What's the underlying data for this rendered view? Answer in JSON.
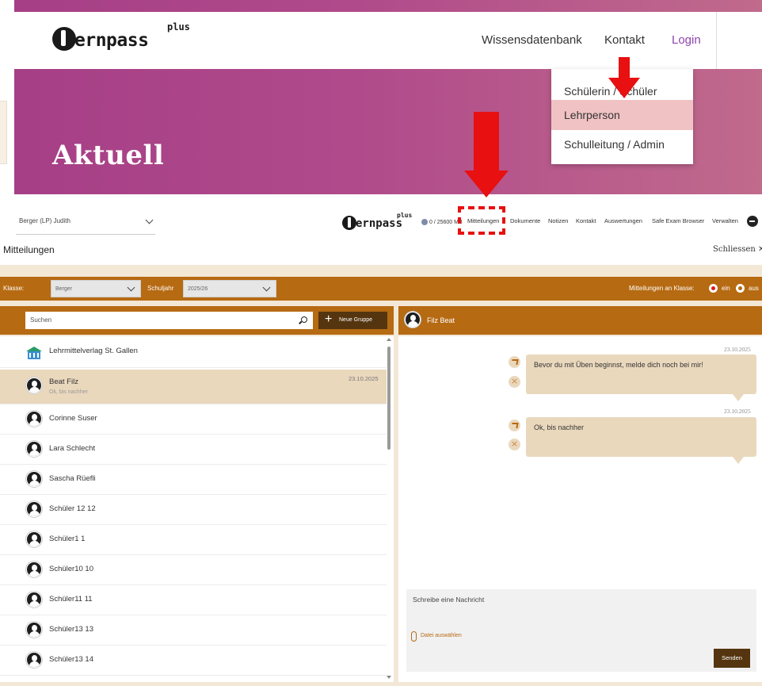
{
  "website": {
    "logo_text": "ernpass",
    "logo_sup": "plus",
    "nav": [
      "Wissensdatenbank",
      "Kontakt",
      "Login"
    ],
    "hero_title": "Aktuell",
    "login_dropdown": [
      "Schülerin / Schüler",
      "Lehrperson",
      "Schulleitung / Admin"
    ]
  },
  "app": {
    "user_selector": "Berger (LP) Judith",
    "logo_text": "ernpass",
    "logo_sup": "plus",
    "quota": "0 / 25600 MB",
    "nav": [
      "Mitteilungen",
      "Dokumente",
      "Notizen",
      "Kontakt",
      "Auswertungen",
      "Safe Exam Browser",
      "Verwalten"
    ],
    "page_title": "Mitteilungen",
    "close_label": "Schliessen"
  },
  "class_bar": {
    "class_label": "Klasse:",
    "class_value": "Berger",
    "year_label": "Schuljahr",
    "year_value": "2025/26",
    "messages_label": "Mitteilungen an Klasse:",
    "on_label": "ein",
    "off_label": "aus",
    "messages_enabled": true
  },
  "search": {
    "placeholder": "Suchen",
    "new_group_label": "Neue Gruppe"
  },
  "contacts": [
    {
      "name": "Lehrmittelverlag St. Gallen",
      "type": "school"
    },
    {
      "name": "Beat Filz",
      "preview": "Ok, bis nachher",
      "date": "23.10.2025",
      "selected": true
    },
    {
      "name": "Corinne Suser"
    },
    {
      "name": "Lara Schlecht"
    },
    {
      "name": "Sascha Rüefli"
    },
    {
      "name": "Schüler 12 12"
    },
    {
      "name": "Schüler1 1"
    },
    {
      "name": "Schüler10 10"
    },
    {
      "name": "Schüler11 11"
    },
    {
      "name": "Schüler13 13"
    },
    {
      "name": "Schüler13 14"
    }
  ],
  "chat": {
    "header_name": "Filz Beat",
    "messages": [
      {
        "date": "23.10.2025",
        "text": "Bevor du mit Üben beginnst, melde dich noch bei mir!"
      },
      {
        "date": "23.10.2025",
        "text": "Ok, bis nachher"
      }
    ],
    "compose_placeholder": "Schreibe eine Nachricht",
    "attach_label": "Datei auswählen",
    "send_label": "Senden"
  },
  "colors": {
    "brand_purple": "#a63f86",
    "accent_brown": "#b66a12",
    "dark_brown": "#54350f",
    "highlight_red": "#e81010",
    "selected_bg": "#ead8bd"
  }
}
